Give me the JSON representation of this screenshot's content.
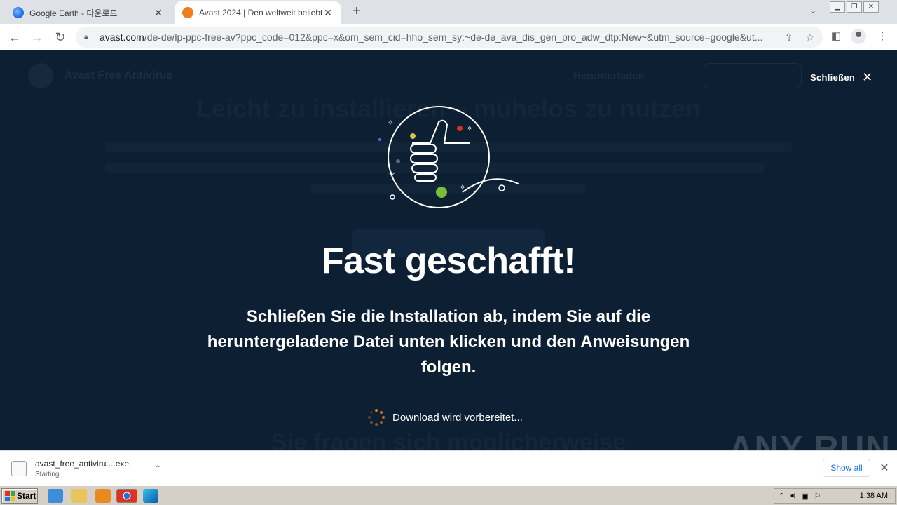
{
  "tabs": [
    {
      "title": "Google Earth - 다운로드",
      "icon": "google-earth-icon"
    },
    {
      "title": "Avast 2024 | Den weltweit beliebtesten",
      "icon": "avast-icon"
    }
  ],
  "toolbar": {
    "url_host": "avast.com",
    "url_path": "/de-de/lp-ppc-free-av?ppc_code=012&ppc=x&om_sem_cid=hho_sem_sy:~de-de_ava_dis_gen_pro_adw_dtp:New~&utm_source=google&ut..."
  },
  "background": {
    "brand": "Avast Free Antivirus",
    "nav_link": "Herunterladen",
    "heading": "Leicht zu installieren – mühelos zu nutzen",
    "bottom_heading": "Sie fragen sich möglicherweise"
  },
  "modal": {
    "close_label": "Schließen",
    "headline": "Fast geschafft!",
    "subtext": "Schließen Sie die Installation ab, indem Sie auf die heruntergeladene Datei unten klicken und den Anweisungen folgen.",
    "progress_text": "Download wird vorbereitet..."
  },
  "watermark": "ANY RUN",
  "download": {
    "filename": "avast_free_antiviru....exe",
    "status": "Starting...",
    "show_all": "Show all"
  },
  "taskbar": {
    "start_label": "Start",
    "clock": "1:38 AM"
  },
  "colors": {
    "page_bg": "#0d1f33",
    "accent_orange": "#f07e1b",
    "link_blue": "#1a73e8"
  }
}
